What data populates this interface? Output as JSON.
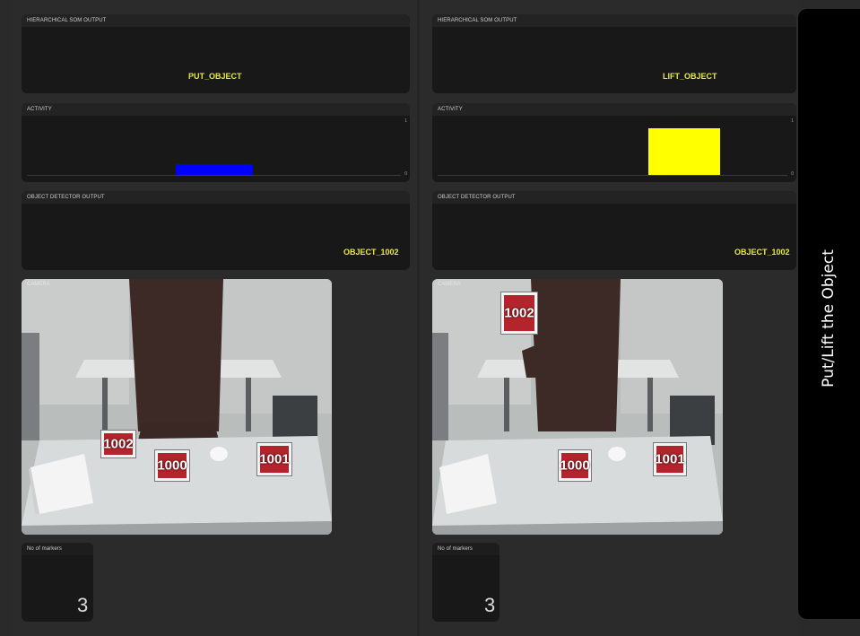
{
  "left": {
    "som": {
      "title": "HIERARCHICAL SOM OUTPUT",
      "value": "PUT_OBJECT"
    },
    "activity": {
      "title": "ACTIVITY",
      "tick_max": "1",
      "tick_min": "0",
      "bar_level": 0.18,
      "bar_color": "#0000ff"
    },
    "detector": {
      "title": "OBJECT DETECTOR OUTPUT",
      "value": "OBJECT_1002"
    },
    "camera": {
      "title": "CAMERA",
      "markers": [
        "1002",
        "1000",
        "1001"
      ]
    },
    "markers_count": {
      "title": "No of markers",
      "value": "3"
    }
  },
  "right": {
    "som": {
      "title": "HIERARCHICAL SOM OUTPUT",
      "value": "LIFT_OBJECT"
    },
    "activity": {
      "title": "ACTIVITY",
      "tick_max": "1",
      "tick_min": "0",
      "bar_level": 0.8,
      "bar_color": "#ffff00"
    },
    "detector": {
      "title": "OBJECT DETECTOR OUTPUT",
      "value": "OBJECT_1002"
    },
    "camera": {
      "title": "CAMERA",
      "markers": [
        "1002",
        "1000",
        "1001"
      ]
    },
    "markers_count": {
      "title": "No of markers",
      "value": "3"
    }
  },
  "sidebar": {
    "label": "Put/Lift the Object"
  },
  "colors": {
    "accent_text": "#e8e84a",
    "panel_bg": "#181818",
    "page_bg": "#2a2a2a"
  }
}
